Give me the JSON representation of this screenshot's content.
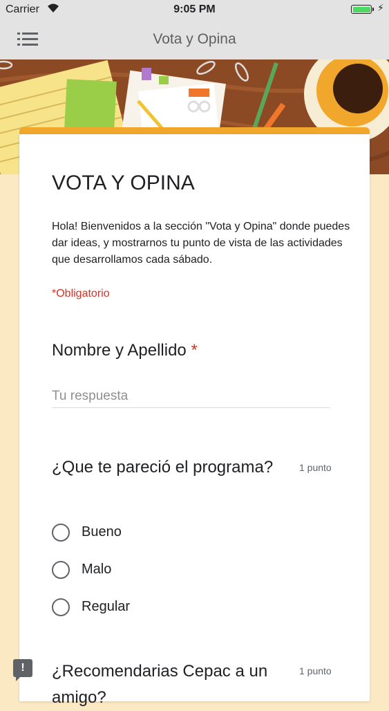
{
  "status_bar": {
    "carrier": "Carrier",
    "time": "9:05 PM"
  },
  "nav": {
    "title": "Vota y Opina",
    "menu_icon": "menu-icon"
  },
  "form": {
    "title": "VOTA Y OPINA",
    "description": "Hola! Bienvenidos a la sección \"Vota y Opina\" donde puedes dar ideas, y mostrarnos tu punto de vista de las actividades que desarrollamos cada sábado.",
    "required_note": "*Obligatorio",
    "accent_color": "#f0a72b"
  },
  "questions": [
    {
      "title": "Nombre y Apellido",
      "required_mark": "*",
      "placeholder": "Tu respuesta"
    },
    {
      "title": "¿Que te pareció el programa?",
      "points": "1 punto",
      "options": [
        "Bueno",
        "Malo",
        "Regular"
      ]
    },
    {
      "title": "¿Recomendarias Cepac a un amigo?",
      "points": "1 punto"
    }
  ],
  "feedback_icon": "feedback-icon"
}
